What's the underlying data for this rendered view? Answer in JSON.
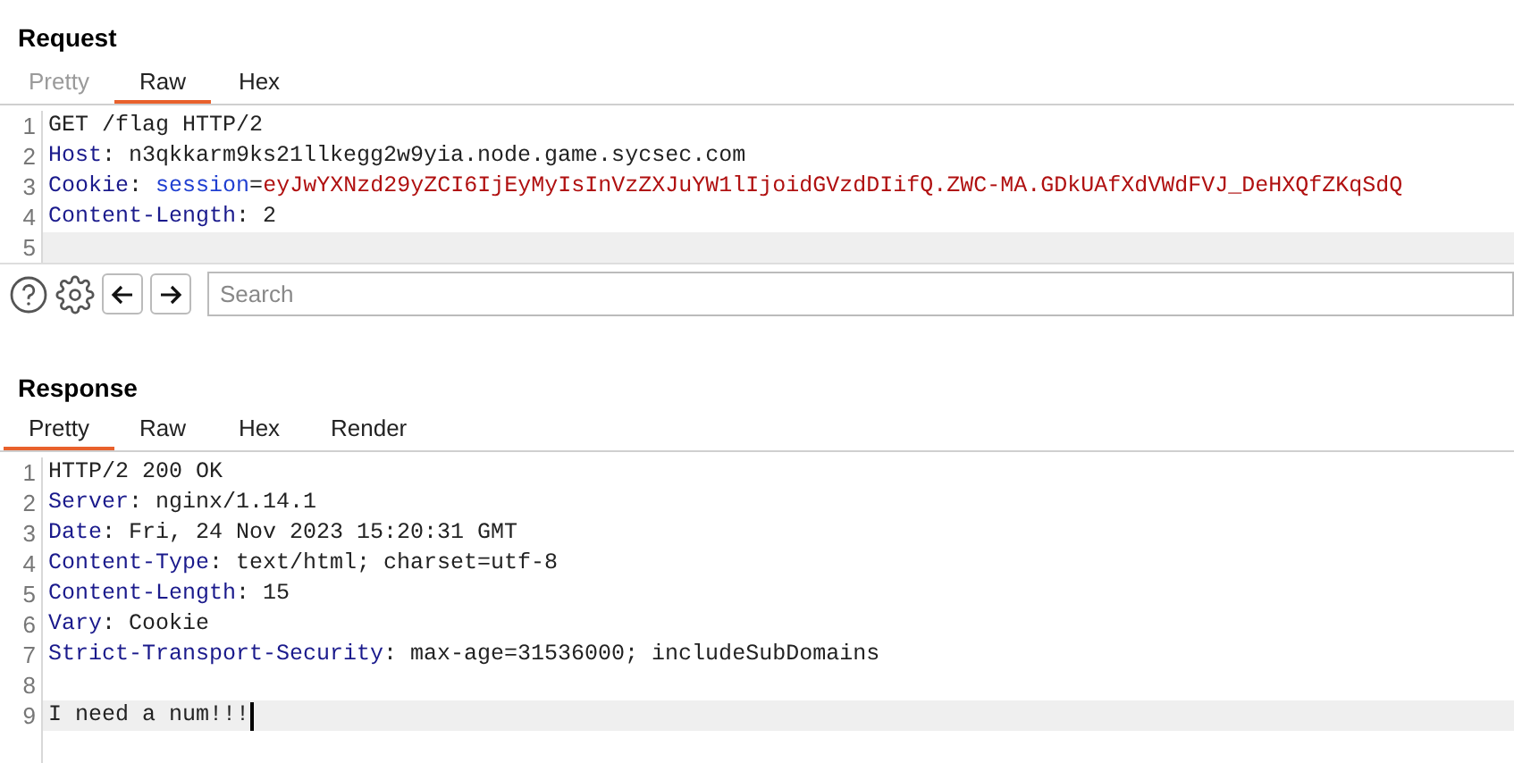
{
  "request": {
    "title": "Request",
    "tabs": [
      {
        "label": "Pretty",
        "selected": false,
        "disabled": true
      },
      {
        "label": "Raw",
        "selected": true,
        "disabled": false
      },
      {
        "label": "Hex",
        "selected": false,
        "disabled": false
      }
    ],
    "lines": [
      {
        "number": "1",
        "current": false,
        "cursor": false,
        "segments": [
          {
            "kind": "plain",
            "text": "GET /flag HTTP/2"
          }
        ]
      },
      {
        "number": "2",
        "current": false,
        "cursor": false,
        "segments": [
          {
            "kind": "header",
            "text": "Host"
          },
          {
            "kind": "plain",
            "text": ": n3qkkarm9ks21llkegg2w9yia.node.game.sycsec.com"
          }
        ]
      },
      {
        "number": "3",
        "current": false,
        "cursor": false,
        "segments": [
          {
            "kind": "header",
            "text": "Cookie"
          },
          {
            "kind": "plain",
            "text": ": "
          },
          {
            "kind": "param",
            "text": "session"
          },
          {
            "kind": "plain",
            "text": "="
          },
          {
            "kind": "value",
            "text": "eyJwYXNzd29yZCI6IjEyMyIsInVzZXJuYW1lIjoidGVzdDIifQ.ZWC-MA.GDkUAfXdVWdFVJ_DeHXQfZKqSdQ"
          }
        ]
      },
      {
        "number": "4",
        "current": false,
        "cursor": false,
        "segments": [
          {
            "kind": "header",
            "text": "Content-Length"
          },
          {
            "kind": "plain",
            "text": ": 2"
          }
        ]
      },
      {
        "number": "5",
        "current": true,
        "cursor": false
      }
    ]
  },
  "toolbar": {
    "search": {
      "placeholder": "Search"
    }
  },
  "response": {
    "title": "Response",
    "tabs": [
      {
        "label": "Pretty",
        "selected": true,
        "disabled": false
      },
      {
        "label": "Raw",
        "selected": false,
        "disabled": false
      },
      {
        "label": "Hex",
        "selected": false,
        "disabled": false
      },
      {
        "label": "Render",
        "selected": false,
        "disabled": false
      }
    ],
    "lines": [
      {
        "number": "1",
        "current": false,
        "cursor": false,
        "segments": [
          {
            "kind": "plain",
            "text": "HTTP/2 200 OK"
          }
        ]
      },
      {
        "number": "2",
        "current": false,
        "cursor": false,
        "segments": [
          {
            "kind": "header",
            "text": "Server"
          },
          {
            "kind": "plain",
            "text": ": nginx/1.14.1"
          }
        ]
      },
      {
        "number": "3",
        "current": false,
        "cursor": false,
        "segments": [
          {
            "kind": "header",
            "text": "Date"
          },
          {
            "kind": "plain",
            "text": ": Fri, 24 Nov 2023 15:20:31 GMT"
          }
        ]
      },
      {
        "number": "4",
        "current": false,
        "cursor": false,
        "segments": [
          {
            "kind": "header",
            "text": "Content-Type"
          },
          {
            "kind": "plain",
            "text": ": text/html; charset=utf-8"
          }
        ]
      },
      {
        "number": "5",
        "current": false,
        "cursor": false,
        "segments": [
          {
            "kind": "header",
            "text": "Content-Length"
          },
          {
            "kind": "plain",
            "text": ": 15"
          }
        ]
      },
      {
        "number": "6",
        "current": false,
        "cursor": false,
        "segments": [
          {
            "kind": "header",
            "text": "Vary"
          },
          {
            "kind": "plain",
            "text": ": Cookie"
          }
        ]
      },
      {
        "number": "7",
        "current": false,
        "cursor": false,
        "segments": [
          {
            "kind": "header",
            "text": "Strict-Transport-Security"
          },
          {
            "kind": "plain",
            "text": ": max-age=31536000; includeSubDomains"
          }
        ]
      },
      {
        "number": "8",
        "current": false,
        "cursor": false
      },
      {
        "number": "9",
        "current": true,
        "cursor": true,
        "segments": [
          {
            "kind": "plain",
            "text": "I need a num!!!"
          }
        ]
      }
    ]
  }
}
